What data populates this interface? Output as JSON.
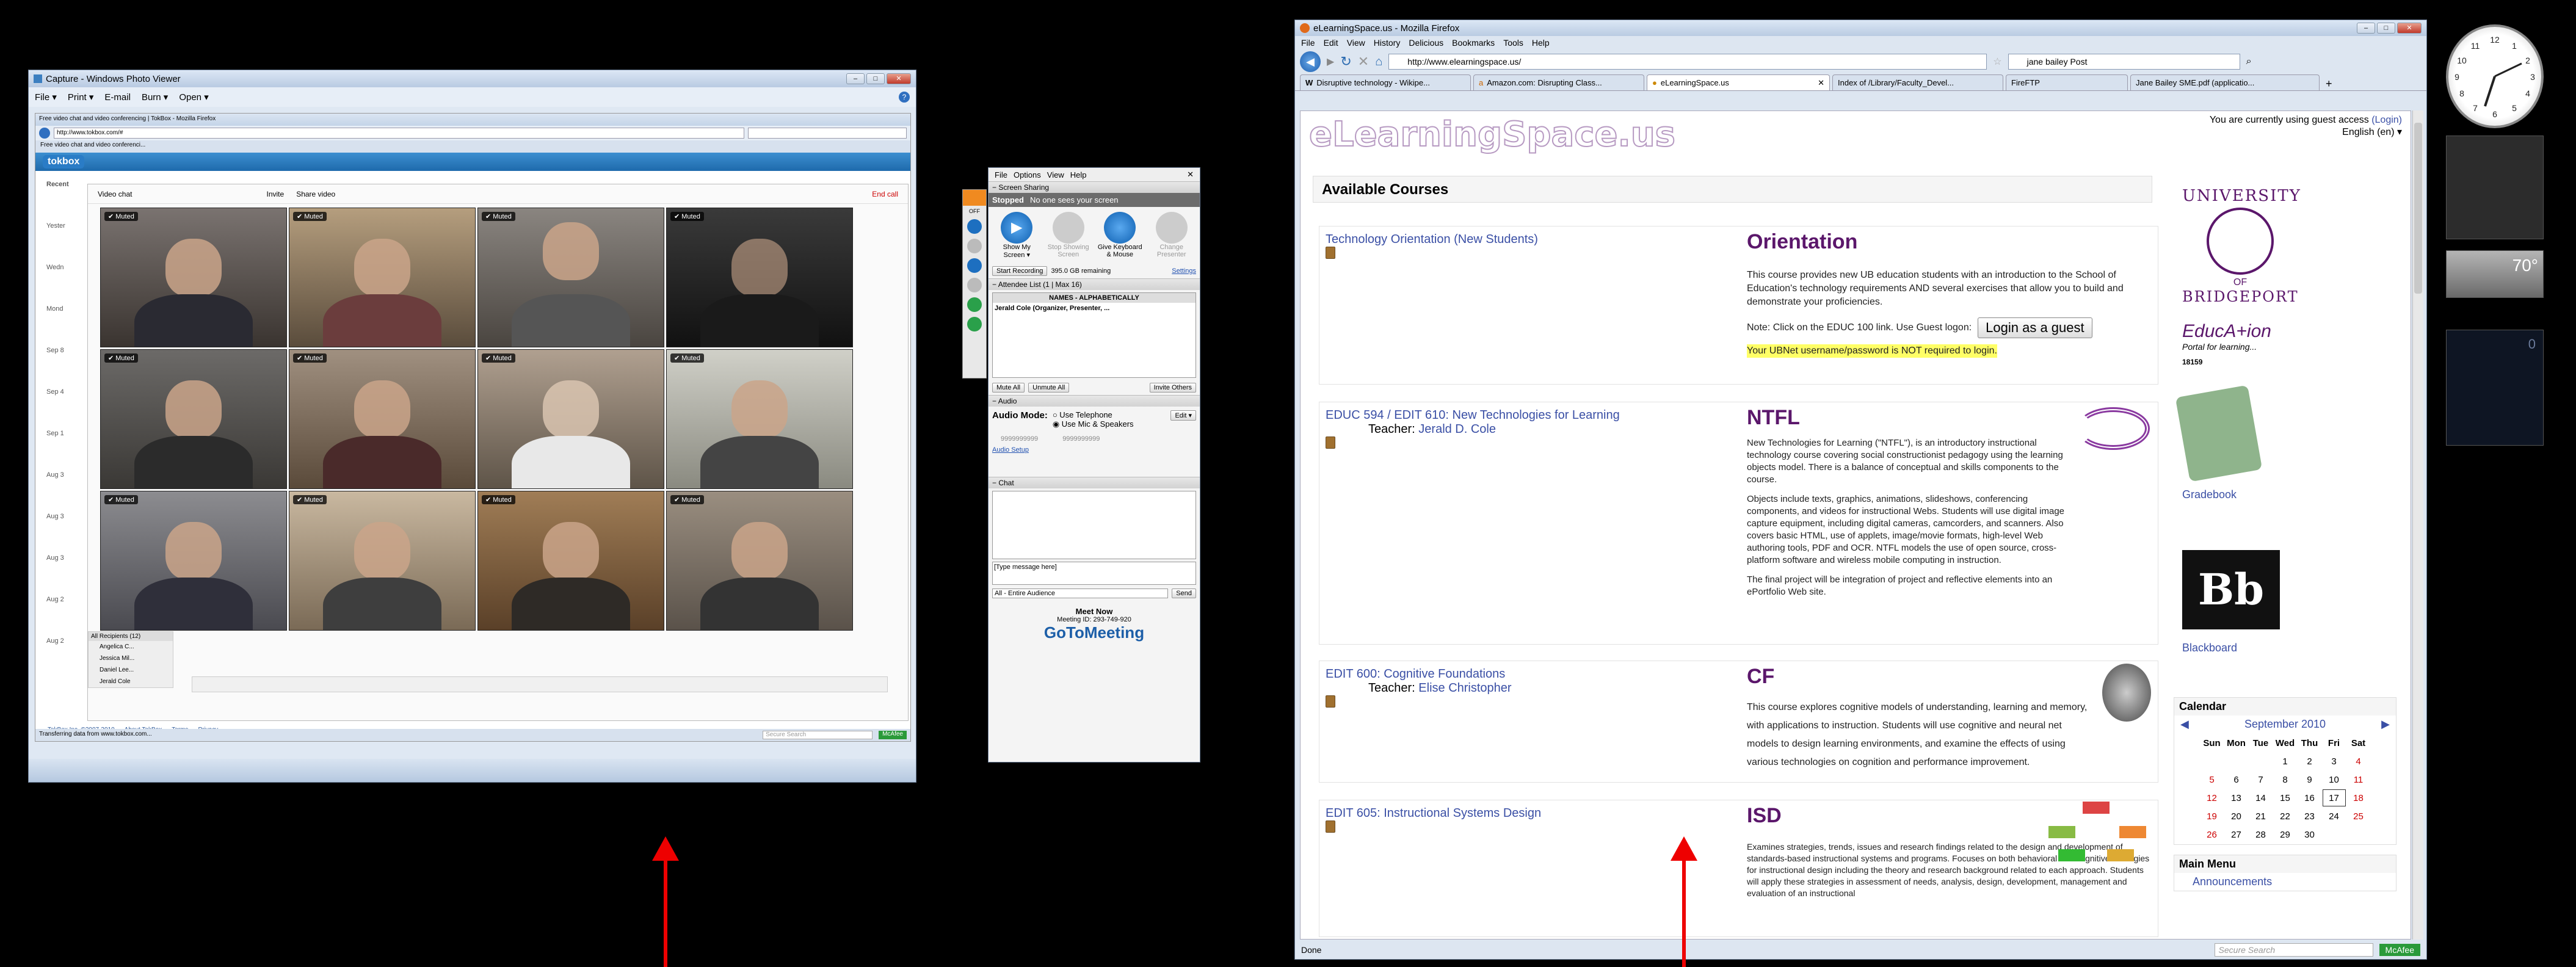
{
  "photo_viewer": {
    "title": "Capture - Windows Photo Viewer",
    "menu": [
      "File ▾",
      "Print ▾",
      "E-mail",
      "Burn ▾",
      "Open ▾"
    ],
    "inner_browser": {
      "title": "Free video chat and video conferencing | TokBox - Mozilla Firefox",
      "url": "http://www.tokbox.com/#",
      "tab": "Free video chat and video conferenci...",
      "logo": "tokbox",
      "video_chat_label": "Video chat",
      "invite_label": "Invite",
      "share_label": "Share video",
      "end_call": "End call",
      "muted_label": "✔ Muted",
      "left_list": [
        "Recent",
        "Yester",
        "Wedn",
        "Mond",
        "Sep 8",
        "Sep 4",
        "Sep 1",
        "Aug 3",
        "Aug 3",
        "Aug 3",
        "Aug 2",
        "Aug 2"
      ],
      "recipients_header": "All Recipients (12)",
      "recipients": [
        "Angelica C...",
        "Jessica Mil...",
        "Daniel Lee...",
        "Jerald Cole"
      ],
      "footer_links": [
        "TokBox Inc. ©2007-2010",
        "About TokBox",
        "Terms",
        "Privacy"
      ],
      "status": "Transferring data from www.tokbox.com...",
      "search_placeholder": "Secure Search",
      "mcafee": "McAfee"
    }
  },
  "gotomeeting": {
    "menu": [
      "File",
      "Options",
      "View",
      "Help"
    ],
    "screen_sharing_header": "Screen Sharing",
    "stopped_label": "Stopped",
    "no_one_sees": "No one sees your screen",
    "buttons": [
      "Show My Screen ▾",
      "Stop Showing Screen",
      "Give Keyboard & Mouse",
      "Change Presenter"
    ],
    "start_recording": "Start Recording",
    "remaining": "395.0 GB remaining",
    "settings": "Settings",
    "attendee_header": "Attendee List  (1 | Max 16)",
    "names_header": "NAMES - ALPHABETICALLY",
    "attendee": "Jerald Cole (Organizer, Presenter, ...",
    "mute_all": "Mute All",
    "unmute_all": "Unmute All",
    "invite_others": "Invite Others",
    "audio_header": "Audio",
    "audio_mode": "Audio Mode:",
    "use_telephone": "Use Telephone",
    "use_mic": "Use Mic & Speakers",
    "edit": "Edit ▾",
    "mic_value": "9999999999",
    "spk_value": "9999999999",
    "audio_setup": "Audio Setup",
    "chat_header": "Chat",
    "chat_placeholder": "[Type message here]",
    "audience": "All - Entire Audience",
    "send": "Send",
    "meet_now": "Meet Now",
    "meeting_id": "Meeting ID: 293-749-920",
    "brand": "GoToMeeting"
  },
  "firefox": {
    "title": "eLearningSpace.us - Mozilla Firefox",
    "menu": [
      "File",
      "Edit",
      "View",
      "History",
      "Delicious",
      "Bookmarks",
      "Tools",
      "Help"
    ],
    "url": "http://www.elearningspace.us/",
    "search_value": "jane bailey Post",
    "tabs": [
      "Disruptive technology - Wikipe...",
      "Amazon.com: Disrupting Class...",
      "eLearningSpace.us",
      "Index of /Library/Faculty_Devel...",
      "FireFTP",
      "Jane Bailey SME.pdf (applicatio..."
    ],
    "status": "Done",
    "search_placeholder": "Secure Search",
    "mcafee": "McAfee"
  },
  "site": {
    "logo": "eLearningSpace.us",
    "guest_text": "You are currently using guest access",
    "login": "(Login)",
    "language": "English (en) ▾",
    "available_courses": "Available Courses",
    "courses": [
      {
        "link": "Technology Orientation (New Students)",
        "teacher_label": "",
        "teacher": "",
        "title": "Orientation",
        "desc": "This course provides new UB education students with an introduction to the School of Education's technology requirements AND several exercises that allow you to build and demonstrate your proficiencies.",
        "note": "Note: Click on the EDUC 100 link. Use Guest logon:",
        "guest_button": "Login as a guest",
        "highlight": "Your UBNet username/password is NOT required to login."
      },
      {
        "link": "EDUC 594 / EDIT 610: New Technologies for Learning",
        "teacher_label": "Teacher:",
        "teacher": "Jerald D. Cole",
        "title": "NTFL",
        "desc": "New Technologies for Learning (\"NTFL\"), is an introductory instructional technology course covering social constructionist pedagogy using the learning objects model. There is a balance of conceptual and skills components to the course.",
        "desc2": "Objects include texts, graphics, animations, slideshows, conferencing components, and videos for instructional Webs. Students will use digital image capture equipment, including digital cameras, camcorders, and scanners. Also covers basic HTML, use of applets, image/movie formats, high-level Web authoring tools, PDF and OCR. NTFL models the use of open source, cross-platform software and wireless mobile computing in instruction.",
        "desc3": "The final project will be integration of project and reflective elements into an ePortfolio Web site."
      },
      {
        "link": "EDIT 600: Cognitive Foundations",
        "teacher_label": "Teacher:",
        "teacher": "Elise Christopher",
        "title": "CF",
        "desc": "This course explores cognitive models of understanding, learning and memory, with applications to instruction. Students will use cognitive and neural net models to design learning environments, and examine the effects of using various technologies on cognition and performance improvement."
      },
      {
        "link": "EDIT 605: Instructional Systems Design",
        "teacher_label": "",
        "teacher": "",
        "title": "ISD",
        "desc": "Examines strategies, trends, issues and research findings related to the design and development of standards-based instructional systems and programs. Focuses on both behavioral and cognitive strategies for instructional design including the theory and research background related to each approach. Students will apply these strategies in assessment of needs, analysis, design, development, management and evaluation of an instructional"
      }
    ],
    "sidebar": {
      "univ_top": "UNIVERSITY",
      "univ_of": "OF",
      "univ_bottom": "BRIDGEPORT",
      "educaion": "EducA+ion",
      "portal": "Portal for learning...",
      "code": "18159",
      "gradebook": "Gradebook",
      "blackboard": "Blackboard",
      "calendar_header": "Calendar",
      "month": "September 2010",
      "days": [
        "Sun",
        "Mon",
        "Tue",
        "Wed",
        "Thu",
        "Fri",
        "Sat"
      ],
      "weeks": [
        [
          "",
          "",
          "",
          "1",
          "2",
          "3",
          "4"
        ],
        [
          "5",
          "6",
          "7",
          "8",
          "9",
          "10",
          "11"
        ],
        [
          "12",
          "13",
          "14",
          "15",
          "16",
          "17",
          "18"
        ],
        [
          "19",
          "20",
          "21",
          "22",
          "23",
          "24",
          "25"
        ],
        [
          "26",
          "27",
          "28",
          "29",
          "30",
          "",
          ""
        ]
      ],
      "main_menu": "Main Menu",
      "announcements": "Announcements"
    }
  },
  "gadgets": {
    "clock_numbers": [
      "12",
      "1",
      "2",
      "3",
      "4",
      "5",
      "6",
      "7",
      "8",
      "9",
      "10",
      "11"
    ],
    "weather_temp": "70°",
    "cpu_value": "0"
  },
  "colors": {
    "accent": "#5b176b",
    "link": "#3a4fa5",
    "arrow": "#e00000"
  }
}
